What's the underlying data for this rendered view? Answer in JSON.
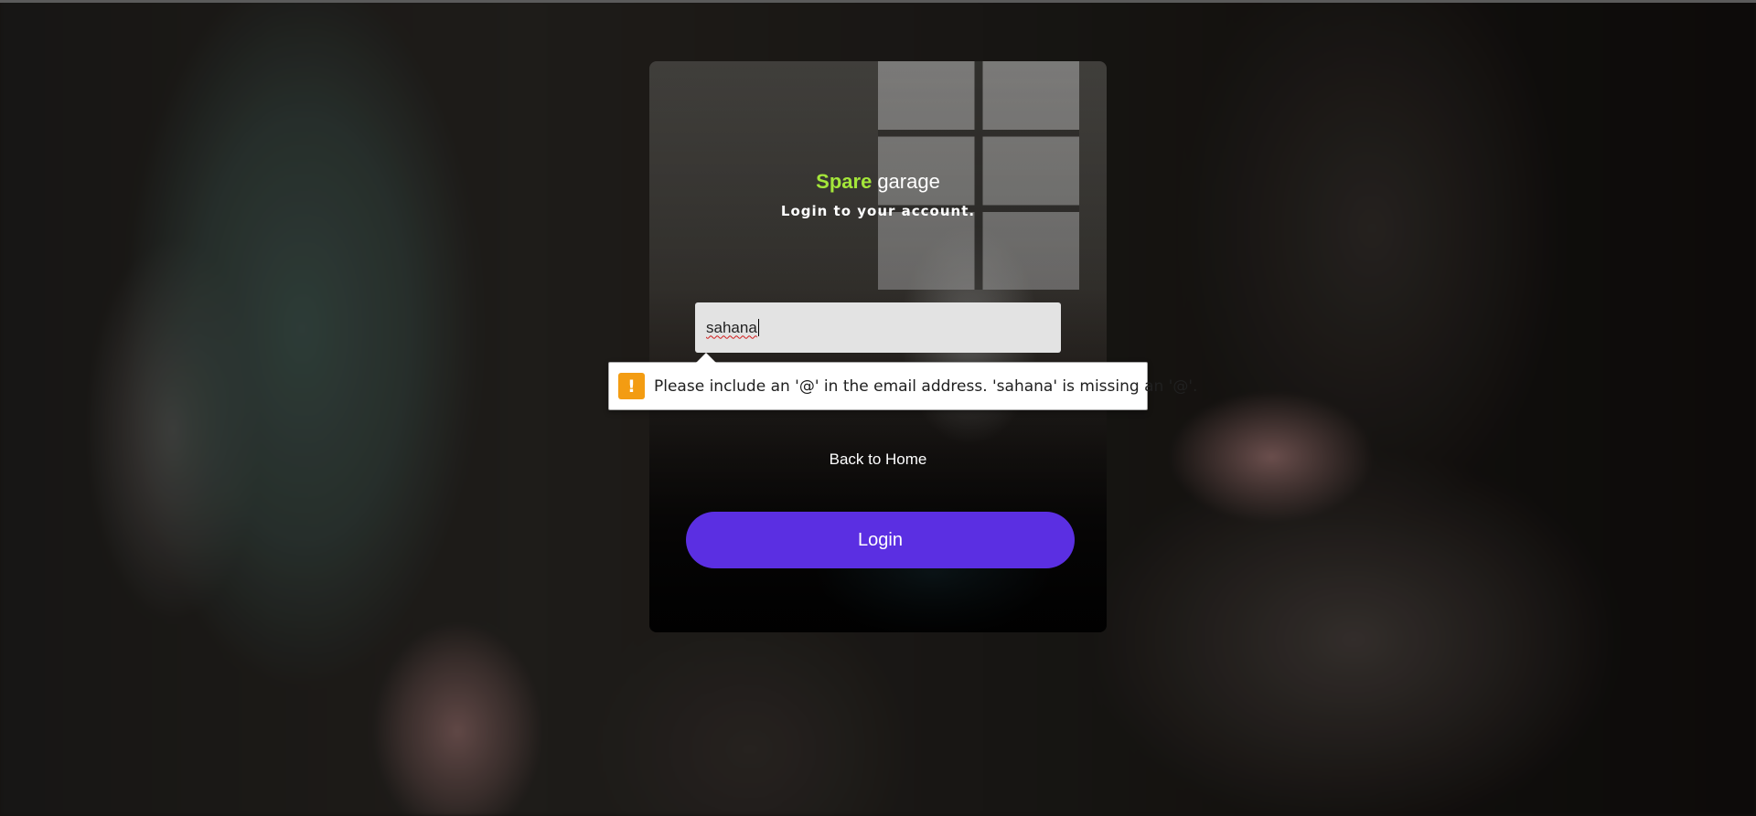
{
  "brand": {
    "accent": "Spare",
    "rest": "garage",
    "accent_color": "#a4e63a"
  },
  "subtitle": "Login to your account.",
  "email_input": {
    "value": "sahana",
    "error_tooltip": "Please include an '@' in the email address. 'sahana' is missing an '@'.",
    "error_icon": "warning-icon"
  },
  "back_link": "Back to Home",
  "login_button": {
    "label": "Login",
    "color": "#5b2fe2"
  }
}
